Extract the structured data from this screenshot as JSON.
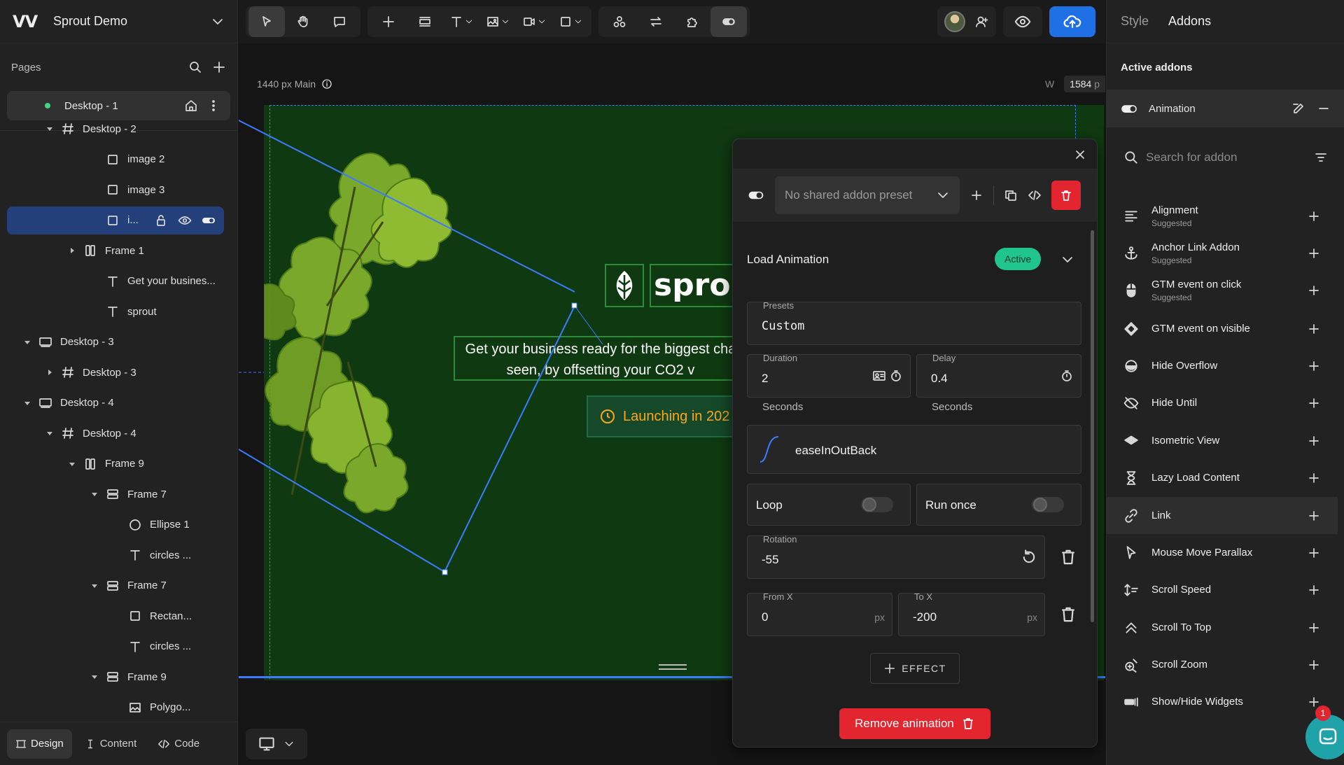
{
  "app": {
    "logo": "VV",
    "project_name": "Sprout Demo"
  },
  "pages": {
    "heading": "Pages",
    "current": "Desktop - 1"
  },
  "layers": [
    {
      "label": "Desktop - 2",
      "icon": "hash-icon",
      "indent": 2,
      "caret": "down"
    },
    {
      "label": "image 2",
      "icon": "square-icon",
      "indent": 4,
      "caret": ""
    },
    {
      "label": "image 3",
      "icon": "square-icon",
      "indent": 4,
      "caret": ""
    },
    {
      "label": "i...",
      "icon": "square-icon",
      "indent": 4,
      "caret": "",
      "selected": true
    },
    {
      "label": "Frame 1",
      "icon": "columns-icon",
      "indent": 3,
      "caret": "right"
    },
    {
      "label": "Get your busines...",
      "icon": "text-icon",
      "indent": 4,
      "caret": ""
    },
    {
      "label": "sprout",
      "icon": "text-icon",
      "indent": 4,
      "caret": ""
    },
    {
      "label": "Desktop - 3",
      "icon": "desktop-icon",
      "indent": 1,
      "caret": "down"
    },
    {
      "label": "Desktop - 3",
      "icon": "hash-icon",
      "indent": 2,
      "caret": "right"
    },
    {
      "label": "Desktop - 4",
      "icon": "desktop-icon",
      "indent": 1,
      "caret": "down"
    },
    {
      "label": "Desktop - 4",
      "icon": "hash-icon",
      "indent": 2,
      "caret": "down"
    },
    {
      "label": "Frame 9",
      "icon": "columns-icon",
      "indent": 3,
      "caret": "down"
    },
    {
      "label": "Frame 7",
      "icon": "rows-icon",
      "indent": 4,
      "caret": "down"
    },
    {
      "label": "Ellipse 1",
      "icon": "circle-icon",
      "indent": 5,
      "caret": ""
    },
    {
      "label": "circles ...",
      "icon": "text-icon",
      "indent": 5,
      "caret": ""
    },
    {
      "label": "Frame 7",
      "icon": "rows-icon",
      "indent": 4,
      "caret": "down"
    },
    {
      "label": "Rectan...",
      "icon": "square-icon",
      "indent": 5,
      "caret": ""
    },
    {
      "label": "circles ...",
      "icon": "text-icon",
      "indent": 5,
      "caret": ""
    },
    {
      "label": "Frame 9",
      "icon": "rows-icon",
      "indent": 4,
      "caret": "down"
    },
    {
      "label": "Polygo...",
      "icon": "image-icon",
      "indent": 5,
      "caret": ""
    }
  ],
  "bottom_tabs": {
    "design": "Design",
    "content": "Content",
    "code": "Code"
  },
  "canvas": {
    "frame_label": "1440 px Main",
    "width_label": "W",
    "width_value": "1584",
    "width_unit": "p",
    "brand_word": "sprout",
    "tagline_line1": "Get your business ready for the biggest cha",
    "tagline_line2": "seen, by offsetting your CO2 v",
    "launch_text": "Launching in 202",
    "brand_green": "#0f3a11",
    "accent_orange": "#ffa51a"
  },
  "panel": {
    "preset_placeholder": "No shared addon preset",
    "title": "Load Animation",
    "status": "Active",
    "presets_label": "Presets",
    "presets_value": "Custom",
    "duration_label": "Duration",
    "duration_value": "2",
    "duration_unit": "Seconds",
    "delay_label": "Delay",
    "delay_value": "0.4",
    "delay_unit": "Seconds",
    "easing": "easeInOutBack",
    "loop_label": "Loop",
    "run_once_label": "Run once",
    "rotation_label": "Rotation",
    "rotation_value": "-55",
    "fromx_label": "From X",
    "fromx_value": "0",
    "tox_label": "To X",
    "tox_value": "-200",
    "px_unit": "px",
    "effect_label": "EFFECT",
    "remove_label": "Remove animation"
  },
  "right": {
    "tab_style": "Style",
    "tab_addons": "Addons",
    "active_heading": "Active addons",
    "active_addon": "Animation",
    "search_placeholder": "Search for addon",
    "addons": [
      {
        "name": "Alignment",
        "sub": "Suggested",
        "icon": "align-icon"
      },
      {
        "name": "Anchor Link Addon",
        "sub": "Suggested",
        "icon": "anchor-icon"
      },
      {
        "name": "GTM event on click",
        "sub": "Suggested",
        "icon": "mouse-icon"
      },
      {
        "name": "GTM event on visible",
        "sub": "",
        "icon": "diamond-icon"
      },
      {
        "name": "Hide Overflow",
        "sub": "",
        "icon": "overflow-icon"
      },
      {
        "name": "Hide Until",
        "sub": "",
        "icon": "eye-off-icon"
      },
      {
        "name": "Isometric View",
        "sub": "",
        "icon": "isometric-icon"
      },
      {
        "name": "Lazy Load Content",
        "sub": "",
        "icon": "hourglass-icon"
      },
      {
        "name": "Link",
        "sub": "",
        "icon": "link-icon",
        "highlight": true
      },
      {
        "name": "Mouse Move Parallax",
        "sub": "",
        "icon": "cursor-icon"
      },
      {
        "name": "Scroll Speed",
        "sub": "",
        "icon": "scroll-speed-icon"
      },
      {
        "name": "Scroll To Top",
        "sub": "",
        "icon": "double-chevron-up-icon"
      },
      {
        "name": "Scroll Zoom",
        "sub": "",
        "icon": "zoom-icon"
      },
      {
        "name": "Show/Hide Widgets",
        "sub": "",
        "icon": "widget-icon"
      }
    ],
    "chat_count": "1"
  }
}
